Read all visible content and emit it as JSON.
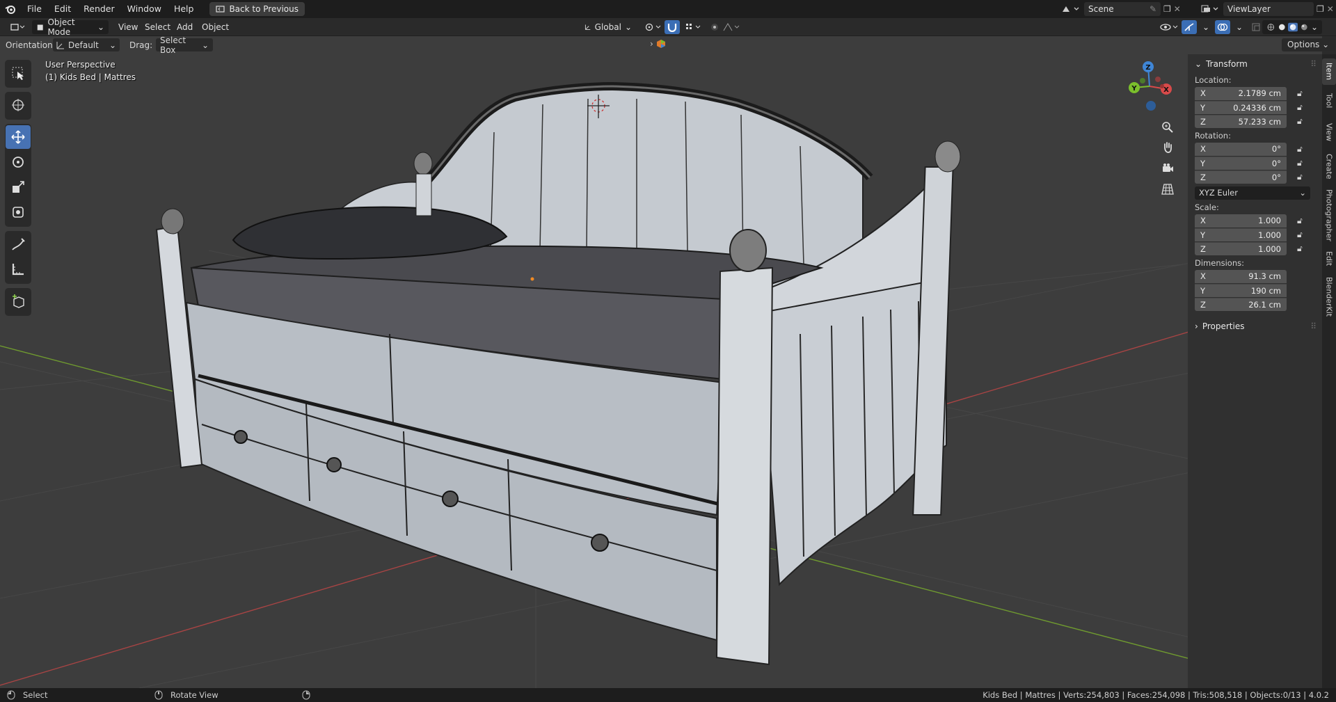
{
  "menubar": {
    "items": [
      "File",
      "Edit",
      "Render",
      "Window",
      "Help"
    ],
    "back_button": "Back to Previous",
    "scene": "Scene",
    "view_layer": "ViewLayer"
  },
  "header": {
    "mode": "Object Mode",
    "menus": [
      "View",
      "Select",
      "Add",
      "Object"
    ],
    "transform_orientation": "Global"
  },
  "tool_options": {
    "orientation_label": "Orientation:",
    "orientation_value": "Default",
    "drag_label": "Drag:",
    "drag_value": "Select Box",
    "options_label": "Options"
  },
  "viewport": {
    "perspective": "User Perspective",
    "object_info": "(1) Kids Bed | Mattres",
    "gizmo_axes": [
      "Z",
      "Y",
      "X"
    ]
  },
  "npanel": {
    "transform_title": "Transform",
    "location_label": "Location:",
    "location": [
      {
        "axis": "X",
        "value": "2.1789 cm"
      },
      {
        "axis": "Y",
        "value": "0.24336 cm"
      },
      {
        "axis": "Z",
        "value": "57.233 cm"
      }
    ],
    "rotation_label": "Rotation:",
    "rotation": [
      {
        "axis": "X",
        "value": "0°"
      },
      {
        "axis": "Y",
        "value": "0°"
      },
      {
        "axis": "Z",
        "value": "0°"
      }
    ],
    "rotation_mode": "XYZ Euler",
    "scale_label": "Scale:",
    "scale": [
      {
        "axis": "X",
        "value": "1.000"
      },
      {
        "axis": "Y",
        "value": "1.000"
      },
      {
        "axis": "Z",
        "value": "1.000"
      }
    ],
    "dimensions_label": "Dimensions:",
    "dimensions": [
      {
        "axis": "X",
        "value": "91.3 cm"
      },
      {
        "axis": "Y",
        "value": "190 cm"
      },
      {
        "axis": "Z",
        "value": "26.1 cm"
      }
    ],
    "properties_title": "Properties"
  },
  "sidebar_tabs": [
    "Item",
    "Tool",
    "View",
    "Create",
    "Photographer",
    "Edit",
    "BlenderKit"
  ],
  "statusbar": {
    "left_action": "Select",
    "middle_action": "Rotate View",
    "stats": "Kids Bed | Mattres | Verts:254,803 | Faces:254,098 | Tris:508,518 | Objects:0/13 | 4.0.2"
  },
  "colors": {
    "accent": "#4772b3",
    "x_axis": "#d84a4a",
    "y_axis": "#7bbf2c",
    "z_axis": "#3f86d6"
  }
}
